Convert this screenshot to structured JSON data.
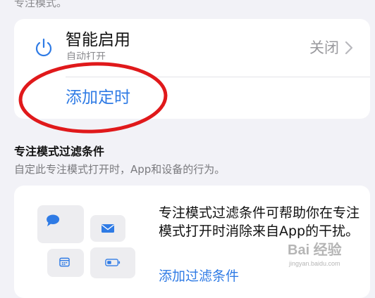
{
  "header": {
    "caption": "专注模式。"
  },
  "smart_activation": {
    "title": "智能启用",
    "subtitle": "自动打开",
    "value": "关闭"
  },
  "schedule": {
    "add_label": "添加定时"
  },
  "filters": {
    "header": "专注模式过滤条件",
    "description": "自定此专注模式打开时，App和设备的行为。",
    "info_text": "专注模式过滤条件可帮助你在专注模式打开时消除来自App的干扰。",
    "add_label": "添加过滤条件"
  },
  "watermark": {
    "main": "Bai 经验",
    "sub": "jingyan.baidu.com"
  },
  "colors": {
    "accent": "#2f7be5",
    "annotation": "#e0191b",
    "background": "#f2f2f7"
  },
  "icons": [
    "power-icon",
    "chevron-right-icon",
    "message-bubble-icon",
    "mail-icon",
    "calendar-icon",
    "battery-icon"
  ]
}
